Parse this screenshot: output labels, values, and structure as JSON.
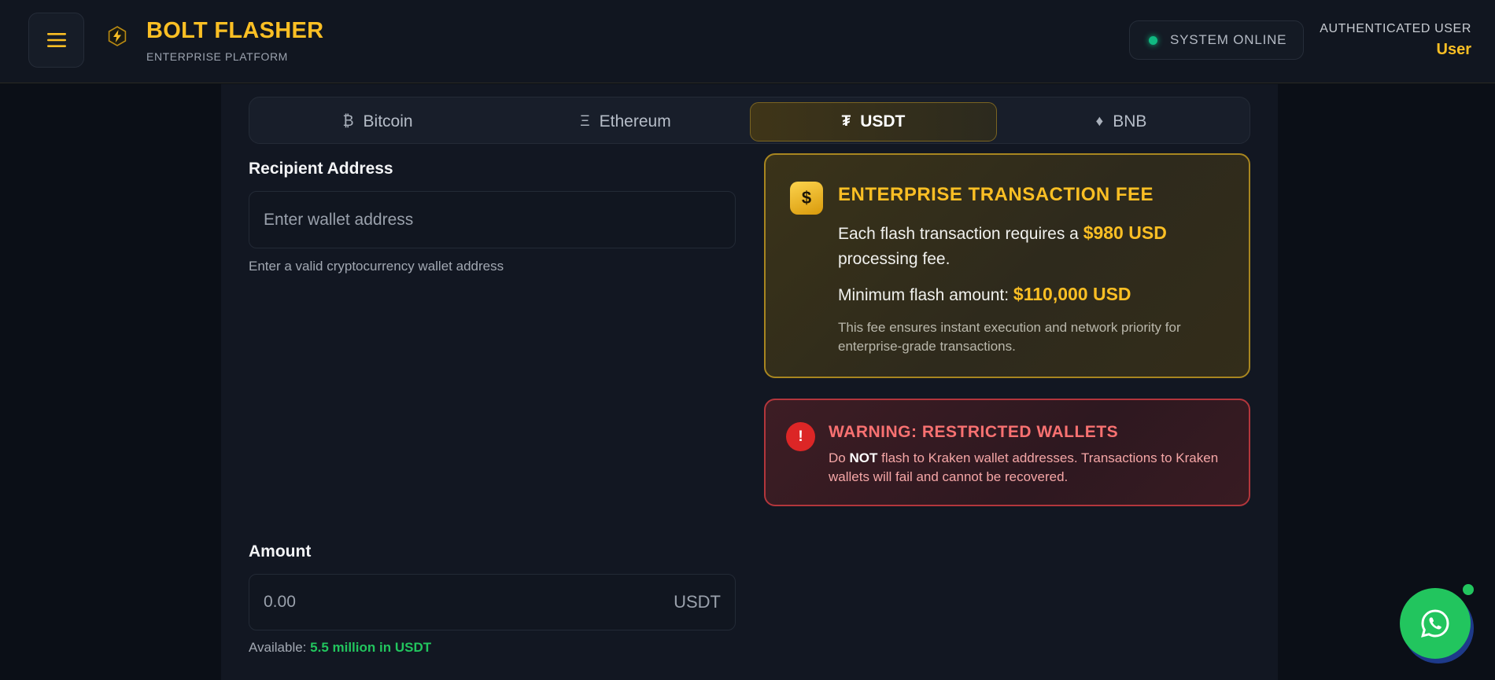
{
  "header": {
    "brand_title": "BOLT FLASHER",
    "brand_subtitle": "ENTERPRISE PLATFORM",
    "status_text": "SYSTEM ONLINE",
    "auth_label": "AUTHENTICATED USER",
    "auth_user": "User"
  },
  "tabs": [
    {
      "glyph": "₿",
      "label": "Bitcoin",
      "active": false
    },
    {
      "glyph": "Ξ",
      "label": "Ethereum",
      "active": false
    },
    {
      "glyph": "₮",
      "label": "USDT",
      "active": true
    },
    {
      "glyph": "♦",
      "label": "BNB",
      "active": false
    }
  ],
  "recipient": {
    "label": "Recipient Address",
    "placeholder": "Enter wallet address",
    "value": "",
    "helper": "Enter a valid cryptocurrency wallet address"
  },
  "amount": {
    "label": "Amount",
    "placeholder": "0.00",
    "value": "",
    "unit": "USDT",
    "available_label": "Available:",
    "available_value": "5.5 million in USDT"
  },
  "fee_card": {
    "icon": "$",
    "title": "ENTERPRISE TRANSACTION FEE",
    "line1_prefix": "Each flash transaction requires a",
    "line1_amount": "$980 USD",
    "line1_suffix": "processing fee.",
    "line2_prefix": "Minimum flash amount:",
    "line2_amount": "$110,000 USD",
    "note": "This fee ensures instant execution and network priority for enterprise-grade transactions."
  },
  "warning_card": {
    "icon": "!",
    "title": "WARNING: RESTRICTED WALLETS",
    "text_prefix": "Do",
    "text_emphasis": "NOT",
    "text_suffix": "flash to Kraken wallet addresses. Transactions to Kraken wallets will fail and cannot be recovered."
  },
  "colors": {
    "accent": "#fbbf24",
    "online": "#10b981",
    "warning": "#dc2626",
    "whatsapp": "#22c55e"
  },
  "icons": {
    "menu": "hamburger-icon",
    "logo": "bolt-icon",
    "whatsapp": "whatsapp-icon"
  }
}
